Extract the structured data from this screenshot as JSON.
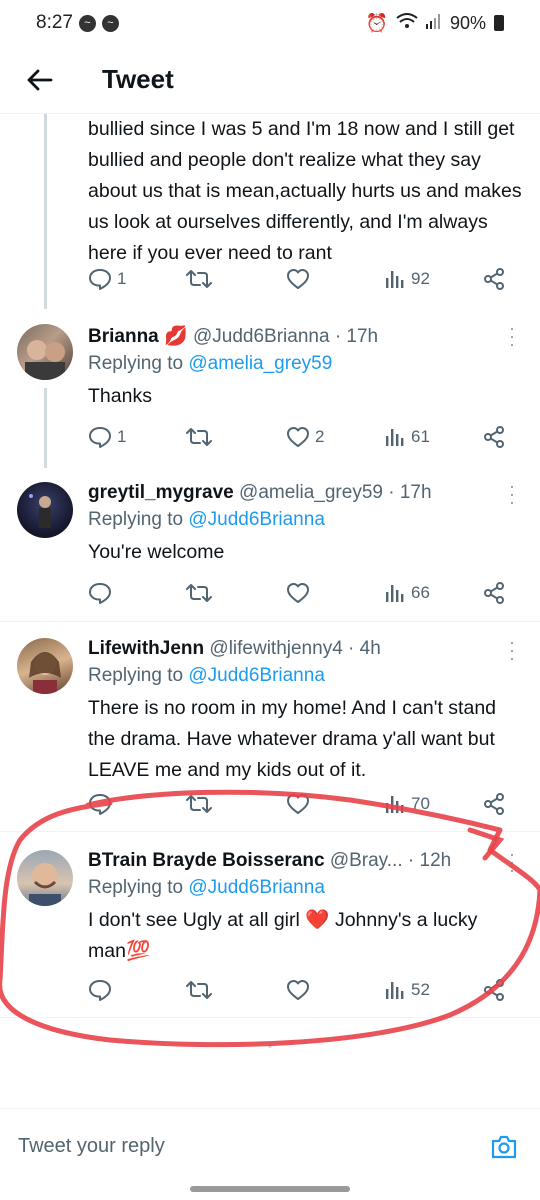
{
  "status_bar": {
    "time": "8:27",
    "battery": "90%"
  },
  "header": {
    "title": "Tweet"
  },
  "tweets": [
    {
      "body": "bullied since I was 5 and I'm 18 now and I still get bullied and people don't realize what they say about us that is mean,actually hurts us and makes us look at ourselves differently, and I'm always here if you ever need to rant",
      "replies": "1",
      "retweets": "",
      "likes": "",
      "views": "92"
    },
    {
      "name": "Brianna",
      "name_emoji": "💋",
      "handle": "@Judd6Brianna",
      "time": "· 17h",
      "replying_label": "Replying to",
      "replying_to": "@amelia_grey59",
      "body": "Thanks",
      "replies": "1",
      "retweets": "",
      "likes": "2",
      "views": "61"
    },
    {
      "name": "greytil_mygrave",
      "handle": "@amelia_grey59",
      "time": "· 17h",
      "replying_label": "Replying to",
      "replying_to": "@Judd6Brianna",
      "body": "You're welcome",
      "replies": "",
      "retweets": "",
      "likes": "",
      "views": "66"
    },
    {
      "name": "LifewithJenn",
      "handle": "@lifewithjenny4",
      "time": "· 4h",
      "replying_label": "Replying to",
      "replying_to": "@Judd6Brianna",
      "body": "There is no room in my home! And I can't stand the drama. Have whatever drama y'all want but LEAVE me and my kids out of it.",
      "replies": "",
      "retweets": "",
      "likes": "",
      "views": "70"
    },
    {
      "name": "BTrain Brayde Boisseranc",
      "handle": "@Bray...",
      "time": "· 12h",
      "replying_label": "Replying to",
      "replying_to": "@Judd6Brianna",
      "body_a": "I don't see Ugly at all girl ",
      "body_heart": "❤️",
      "body_b": " Johnny's a lucky man",
      "body_emoji": "💯",
      "replies": "",
      "retweets": "",
      "likes": "",
      "views": "52"
    }
  ],
  "reply_box": {
    "placeholder": "Tweet your reply"
  },
  "colors": {
    "link": "#1d9bf0",
    "muted": "#536471",
    "annotation": "#e8434a"
  },
  "icons": [
    "back-arrow-icon",
    "reply-icon",
    "retweet-icon",
    "like-icon",
    "views-icon",
    "share-icon",
    "more-icon",
    "camera-icon"
  ]
}
